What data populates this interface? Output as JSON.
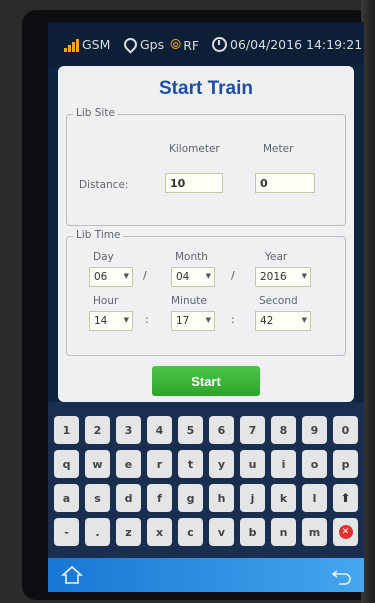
{
  "status_bar": {
    "gsm_label": "GSM",
    "gps_label": "Gps",
    "rf_label": "RF",
    "datetime": "06/04/2016 14:19:21"
  },
  "dialog": {
    "title": "Start Train",
    "lib_site": {
      "legend": "Lib Site",
      "kilometer_label": "Kilometer",
      "meter_label": "Meter",
      "distance_label": "Distance:",
      "kilometer_value": "10",
      "meter_value": "0"
    },
    "lib_time": {
      "legend": "Lib Time",
      "day_label": "Day",
      "month_label": "Month",
      "year_label": "Year",
      "hour_label": "Hour",
      "minute_label": "Minute",
      "second_label": "Second",
      "day_value": "06",
      "month_value": "04",
      "year_value": "2016",
      "hour_value": "14",
      "minute_value": "17",
      "second_value": "42",
      "date_sep": "/",
      "time_sep": ":"
    },
    "start_label": "Start"
  },
  "keyboard": {
    "row1": [
      "1",
      "2",
      "3",
      "4",
      "5",
      "6",
      "7",
      "8",
      "9",
      "0"
    ],
    "row2": [
      "q",
      "w",
      "e",
      "r",
      "t",
      "y",
      "u",
      "i",
      "o",
      "p"
    ],
    "row3": [
      "a",
      "s",
      "d",
      "f",
      "g",
      "h",
      "j",
      "k",
      "l"
    ],
    "row4": [
      "-",
      ".",
      "z",
      "x",
      "c",
      "v",
      "b",
      "n",
      "m"
    ]
  },
  "colors": {
    "accent_title": "#1f4fa3",
    "start_button": "#3bb536",
    "navbar": "#2f8fe0"
  },
  "icons": {
    "signal": "signal-icon",
    "gps": "gps-pin-icon",
    "rf": "rf-wave-icon",
    "clock": "clock-icon",
    "shift": "shift-arrow-icon",
    "delete": "delete-icon",
    "home": "home-icon",
    "back": "back-icon"
  }
}
